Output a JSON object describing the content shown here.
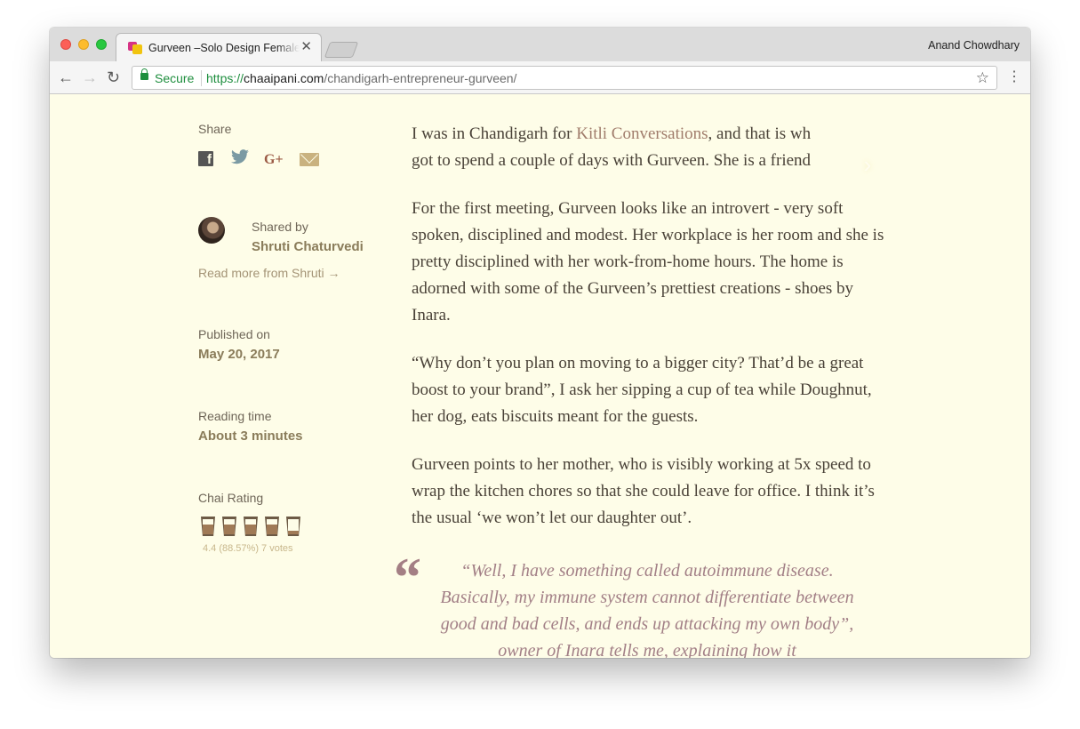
{
  "browser": {
    "tab_title": "Gurveen –Solo Design Female Entrepreneur",
    "tab_close": "✕",
    "profile_name": "Anand Chowdhary",
    "secure_label": "Secure",
    "url_scheme": "https://",
    "url_host": "chaaipani.com",
    "url_path": "/chandigarh-entrepreneur-gurveen/",
    "back_icon": "←",
    "forward_icon": "→",
    "reload_icon": "↻",
    "star_icon": "☆",
    "menu_icon": "⋮"
  },
  "sidebar": {
    "share_label": "Share",
    "social_icons": [
      "facebook-icon",
      "twitter-icon",
      "google-plus-icon",
      "mail-icon"
    ],
    "facebook_glyph": "f",
    "twitter_glyph": "🐦",
    "google_plus_glyph": "G+",
    "shared_by_label": "Shared by",
    "author_name": "Shruti Chaturvedi",
    "read_more": "Read more from Shruti  →",
    "published_label": "Published on",
    "published_date": "May 20, 2017",
    "reading_time_label": "Reading time",
    "reading_time_value": "About 3 minutes",
    "chai_rating_label": "Chai Rating",
    "chai_rating_text": "4.4 (88.57%) 7 votes",
    "chai_rating_value": 4.4,
    "chai_rating_max": 5
  },
  "article": {
    "p1_before_link": "I was in Chandigarh for ",
    "p1_link": "Kitli Conversations",
    "p1_after_link": ", and that is wh",
    "p1_line2": "got to spend a couple of days with Gurveen. She is a friend",
    "p2": "For the first meeting, Gurveen looks like an introvert - very soft spoken, disciplined and modest. Her workplace is her room and she is pretty disciplined with her work-from-home hours. The home is adorned with some of the Gurveen’s prettiest creations - shoes by Inara.",
    "p3": "“Why don’t you plan on moving to a bigger city? That’d be a great boost to your brand”, I ask her sipping a cup of tea while Doughnut, her dog, eats biscuits meant for the guests.",
    "p4": "Gurveen points to her mother, who is visibly working at 5x speed to wrap the kitchen chores so that she could leave for office. I think it’s the usual ‘we won’t let our daughter out’.",
    "quote_mark": "“",
    "quote": "“Well, I have something called autoimmune disease. Basically, my immune system cannot differentiate between good and bad cells, and ends up attacking my own body”, owner of Inara tells me, explaining how it",
    "next_arrow": "›"
  },
  "colors": {
    "page_background": "#fefde8",
    "link": "#a07c6b",
    "quote": "#a27f86",
    "secure_green": "#1e8e3e"
  }
}
